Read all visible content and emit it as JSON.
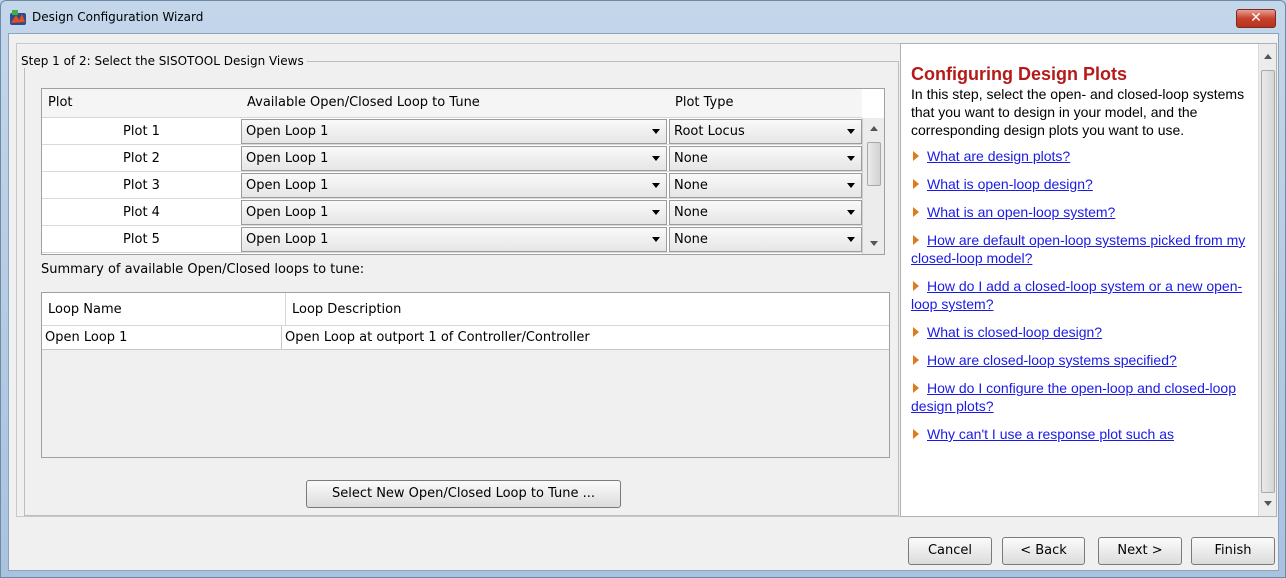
{
  "window": {
    "title": "Design Configuration Wizard",
    "close_glyph": "✕"
  },
  "step": {
    "label": "Step 1 of 2: Select the SISOTOOL Design Views"
  },
  "plot_table": {
    "headers": [
      "Plot",
      "Available Open/Closed Loop to Tune",
      "Plot Type"
    ],
    "rows": [
      {
        "plot": "Plot 1",
        "loop": "Open Loop 1",
        "type": "Root Locus"
      },
      {
        "plot": "Plot 2",
        "loop": "Open Loop 1",
        "type": "None"
      },
      {
        "plot": "Plot 3",
        "loop": "Open Loop 1",
        "type": "None"
      },
      {
        "plot": "Plot 4",
        "loop": "Open Loop 1",
        "type": "None"
      },
      {
        "plot": "Plot 5",
        "loop": "Open Loop 1",
        "type": "None"
      }
    ]
  },
  "summary": {
    "label": "Summary of available Open/Closed loops to tune:"
  },
  "loop_table": {
    "headers": [
      "Loop Name",
      "Loop Description"
    ],
    "rows": [
      {
        "name": "Open Loop 1",
        "description": "Open Loop at outport 1 of Controller/Controller"
      }
    ]
  },
  "select_button": "Select New Open/Closed Loop to Tune ...",
  "help": {
    "title": "Configuring Design Plots",
    "intro": "In this step, select the open- and closed-loop systems that you want to design in your model, and the corresponding design plots you want to use.",
    "links": [
      "What are design plots?",
      "What is open-loop design?",
      "What is an open-loop system?",
      "How are default open-loop systems picked from my closed-loop model?",
      "How do I add a closed-loop system or a new open-loop system?",
      "What is closed-loop design?",
      "How are closed-loop systems specified?",
      "How do I configure the open-loop and closed-loop design plots?",
      "Why can't I use a response plot such as"
    ]
  },
  "footer": {
    "cancel": "Cancel",
    "back": "< Back",
    "next": "Next >",
    "finish": "Finish"
  },
  "colors": {
    "help_title": "#b51a1a",
    "link": "#1a1ae6",
    "bullet": "#e07a1c"
  }
}
